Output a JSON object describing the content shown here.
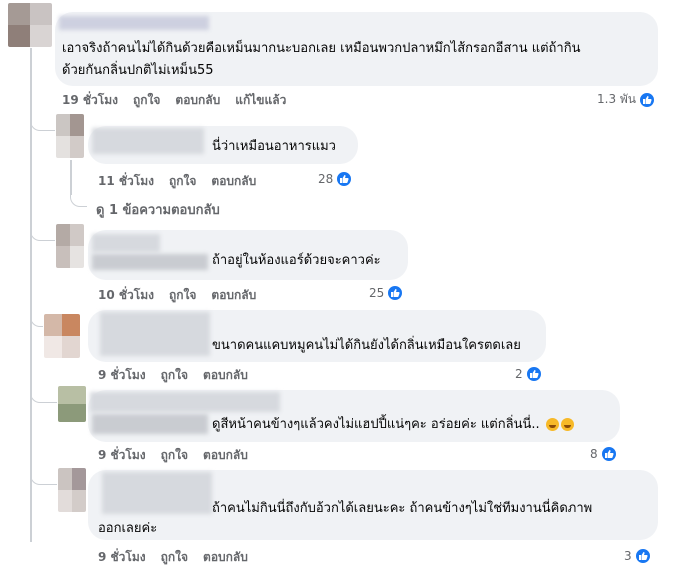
{
  "comments": [
    {
      "text_lines": [
        "เอาจริงถ้าคนไม่ได้กินด้วยคือเหม็นมากนะบอกเลย เหมือนพวกปลาหมึกไส้กรอกอีสาน แต่ถ้ากิน",
        "ด้วยกันกลิ่นปกติไม่เหม็น55"
      ],
      "time": "19 ชั่วโมง",
      "like": "ถูกใจ",
      "reply": "ตอบกลับ",
      "edited": "แก้ไขแล้ว",
      "reactions": "1.3 พัน"
    },
    {
      "text_lines": [
        "นี่ว่าเหมือนอาหารแมว"
      ],
      "time": "11 ชั่วโมง",
      "like": "ถูกใจ",
      "reply": "ตอบกลับ",
      "reactions": "28"
    },
    {
      "text_lines": [
        "ถ้าอยู่ในห้องแอร์ด้วยจะคาวค่ะ"
      ],
      "time": "10 ชั่วโมง",
      "like": "ถูกใจ",
      "reply": "ตอบกลับ",
      "reactions": "25"
    },
    {
      "text_lines": [
        "ขนาดคนแคบหมูคนไม่ได้กินยังได้กลิ่นเหมือนใครตดเลย"
      ],
      "time": "9 ชั่วโมง",
      "like": "ถูกใจ",
      "reply": "ตอบกลับ",
      "reactions": "2"
    },
    {
      "text_lines": [
        "ดูสีหน้าคนข้างๆแล้วคงไม่แฮปปี้แน่ๆคะ อร่อยค่ะ แต่กลิ่นนี่.."
      ],
      "time": "9 ชั่วโมง",
      "like": "ถูกใจ",
      "reply": "ตอบกลับ",
      "reactions": "8"
    },
    {
      "text_lines": [
        "ถ้าคนไม่กินนี่ถึงกับอ้วกได้เลยนะคะ ถ้าคนข้างๆไม่ใช่ทีมงานนี่คิดภาพ",
        "ออกเลยค่ะ"
      ],
      "time": "9 ชั่วโมง",
      "like": "ถูกใจ",
      "reply": "ตอบกลับ",
      "reactions": "3"
    }
  ],
  "view_replies": "ดู 1 ข้อความตอบกลับ",
  "icons": {
    "like": "thumbs-up-icon",
    "emoji": "tired-face-emoji"
  },
  "colors": {
    "bubble": "#f0f2f5",
    "meta": "#65676b",
    "like_blue": "#1877f2"
  }
}
